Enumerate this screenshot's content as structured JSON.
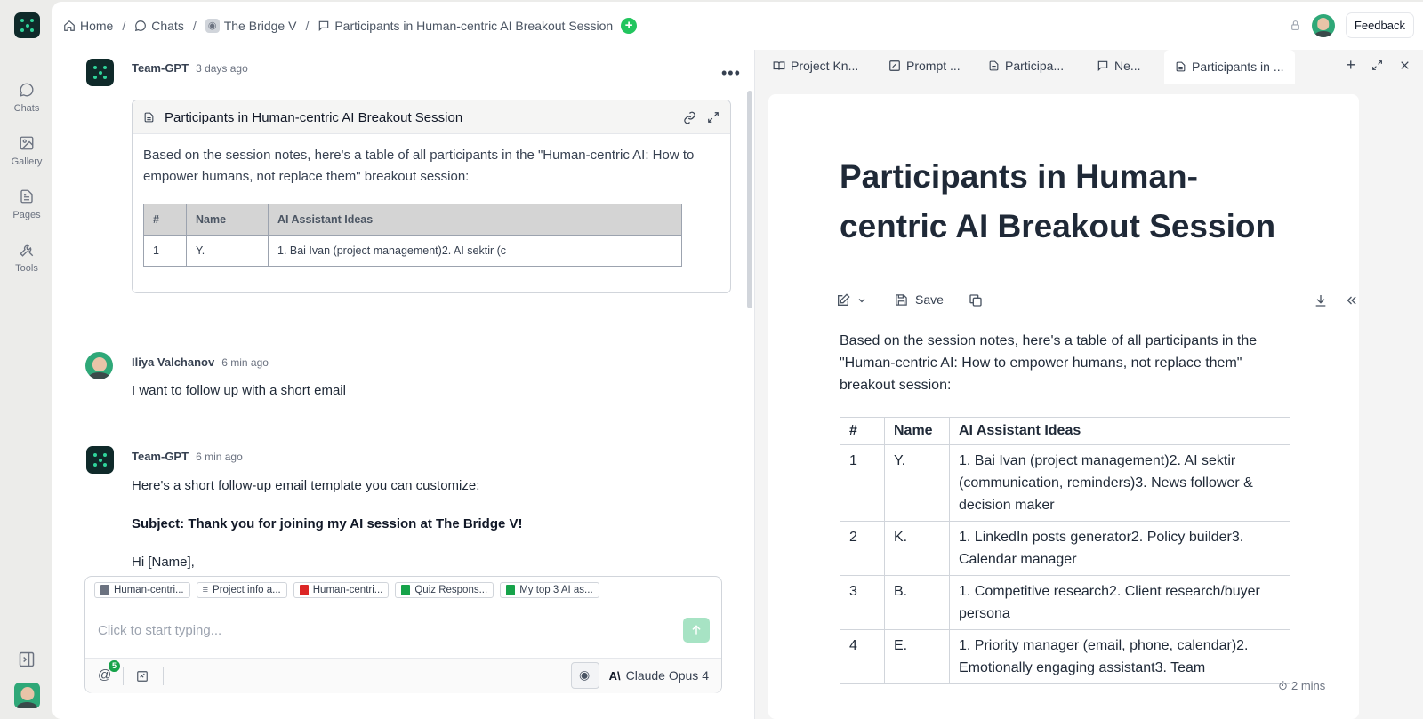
{
  "nav": {
    "items": [
      {
        "label": "Chats",
        "icon": "chat-bubble-icon"
      },
      {
        "label": "Gallery",
        "icon": "image-icon"
      },
      {
        "label": "Pages",
        "icon": "page-icon"
      },
      {
        "label": "Tools",
        "icon": "tools-icon"
      }
    ]
  },
  "breadcrumb": {
    "home": "Home",
    "chats": "Chats",
    "space": "The Bridge V",
    "chat": "Participants in Human-centric AI Breakout Session"
  },
  "topbar": {
    "feedback": "Feedback"
  },
  "messages": {
    "m1": {
      "author": "Team-GPT",
      "time": "3 days ago",
      "card_title": "Participants in Human-centric AI Breakout Session",
      "card_text": "Based on the session notes, here's a table of all participants in the \"Human-centric AI: How to empower humans, not replace them\" breakout session:",
      "table": {
        "headers": [
          "#",
          "Name",
          "AI Assistant Ideas"
        ],
        "row": [
          "1",
          "Y.",
          "1. Bai Ivan (project management)2. AI sektir (c"
        ]
      }
    },
    "m2": {
      "author": "Iliya Valchanov",
      "time": "6 min ago",
      "text": "I want to follow up with a short email"
    },
    "m3": {
      "author": "Team-GPT",
      "time": "6 min ago",
      "line1": "Here's a short follow-up email template you can customize:",
      "subject": "Subject: Thank you for joining my AI session at The Bridge V!",
      "greeting": "Hi [Name],"
    }
  },
  "composer": {
    "chips": [
      "Human-centri...",
      "Project info a...",
      "Human-centri...",
      "Quiz Respons...",
      "My top 3 AI as..."
    ],
    "placeholder": "Click to start typing...",
    "mention_count": "5",
    "model": "Claude Opus 4"
  },
  "tabs": [
    "Project Kn...",
    "Prompt ...",
    "Participa...",
    "Ne...",
    "Participants in ..."
  ],
  "doc": {
    "title": "Participants in Human-centric AI Breakout Session",
    "save": "Save",
    "intro": "Based on the session notes, here's a table of all participants in the \"Human-centric AI: How to empower humans, not replace them\" breakout session:",
    "headers": [
      "#",
      "Name",
      "AI Assistant Ideas"
    ],
    "rows": [
      [
        "1",
        "Y.",
        "1. Bai Ivan (project management)2. AI sektir (communication, reminders)3. News follower & decision maker"
      ],
      [
        "2",
        "K.",
        "1. LinkedIn posts generator2. Policy builder3. Calendar manager"
      ],
      [
        "3",
        "B.",
        "1. Competitive research2. Client research/buyer persona"
      ],
      [
        "4",
        "E.",
        "1. Priority manager (email, phone, calendar)2. Emotionally engaging assistant3. Team"
      ]
    ],
    "read_time": "2 mins"
  }
}
